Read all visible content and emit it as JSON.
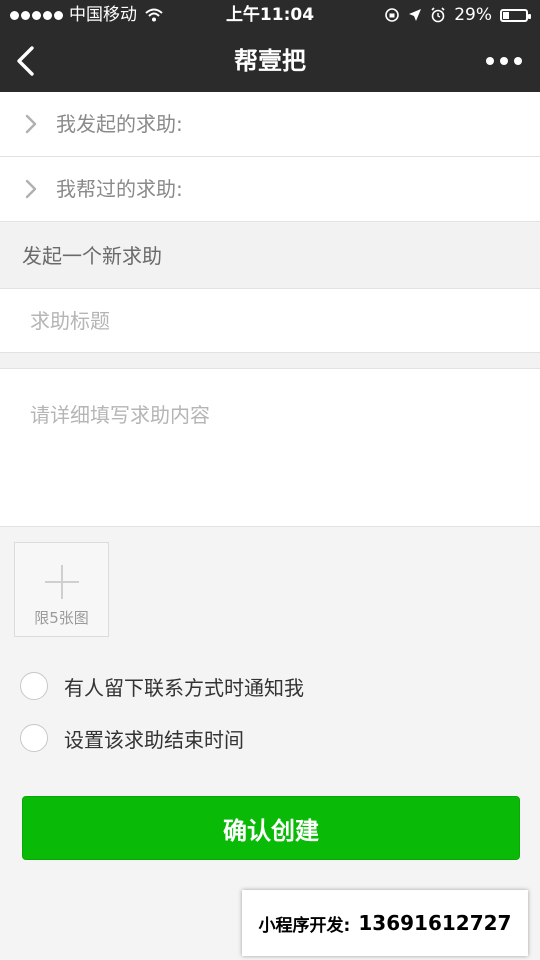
{
  "status_bar": {
    "carrier": "中国移动",
    "time": "上午11:04",
    "battery": "29%",
    "battery_level": 0.29
  },
  "nav": {
    "title": "帮壹把",
    "back_icon": "chevron-left-icon",
    "more_icon": "more-dots-icon"
  },
  "rows": {
    "my_requests": "我发起的求助:",
    "helped": "我帮过的求助:"
  },
  "section": {
    "new_request": "发起一个新求助"
  },
  "form": {
    "title_placeholder": "求助标题",
    "title_value": "",
    "content_placeholder": "请详细填写求助内容",
    "content_value": "",
    "upload_label": "限5张图",
    "notify_label": "有人留下联系方式时通知我",
    "notify_checked": false,
    "end_time_label": "设置该求助结束时间",
    "end_time_checked": false,
    "confirm_label": "确认创建"
  },
  "promo": {
    "label": "小程序开发:",
    "phone": "13691612727"
  },
  "colors": {
    "nav_bg": "#2b2b2b",
    "accent": "#09bb07",
    "page_bg": "#f4f4f4"
  }
}
